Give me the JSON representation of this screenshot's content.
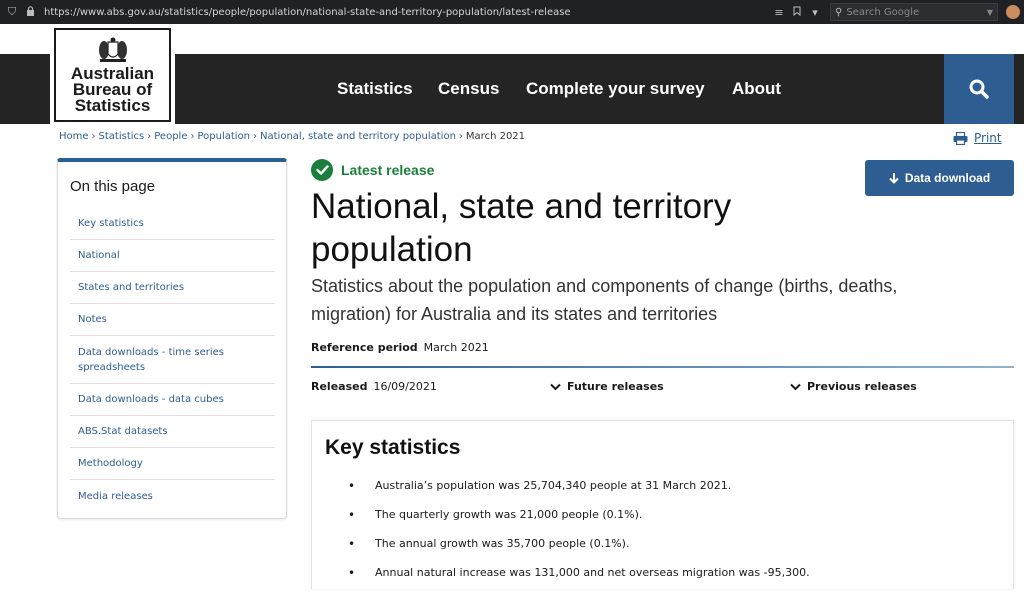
{
  "browser": {
    "url": "https://www.abs.gov.au/statistics/people/population/national-state-and-territory-population/latest-release",
    "search_placeholder": "Search Google"
  },
  "logo": {
    "lines": [
      "Australian",
      "Bureau of",
      "Statistics"
    ]
  },
  "nav": {
    "items": [
      {
        "label": "Statistics"
      },
      {
        "label": "Census"
      },
      {
        "label": "Complete your survey"
      },
      {
        "label": "About"
      }
    ]
  },
  "breadcrumb": {
    "items": [
      "Home",
      "Statistics",
      "People",
      "Population",
      "National, state and territory population"
    ],
    "current": "March 2021"
  },
  "print_label": "Print",
  "sidebar": {
    "title": "On this page",
    "items": [
      "Key statistics",
      "National",
      "States and territories",
      "Notes",
      "Data downloads - time series spreadsheets",
      "Data downloads - data cubes",
      "ABS.Stat datasets",
      "Methodology",
      "Media releases"
    ]
  },
  "release": {
    "badge": "Latest release",
    "title": "National, state and territory population",
    "subtitle": "Statistics about the population and components of change (births, deaths, migration) for Australia and its states and territories",
    "reference_label": "Reference period",
    "reference_value": "March 2021",
    "released_label": "Released",
    "released_value": "16/09/2021",
    "future_releases": "Future releases",
    "previous_releases": "Previous releases",
    "data_download": "Data download"
  },
  "key_statistics": {
    "title": "Key statistics",
    "items": [
      "Australia’s population was 25,704,340 people at 31 March 2021.",
      "The quarterly growth was 21,000 people (0.1%).",
      "The annual growth was 35,700 people (0.1%).",
      "Annual natural increase was 131,000 and net overseas migration was -95,300."
    ]
  },
  "colors": {
    "header_bg": "#242424",
    "accent_blue": "#2e5e91",
    "success_green": "#1a7f3c"
  }
}
